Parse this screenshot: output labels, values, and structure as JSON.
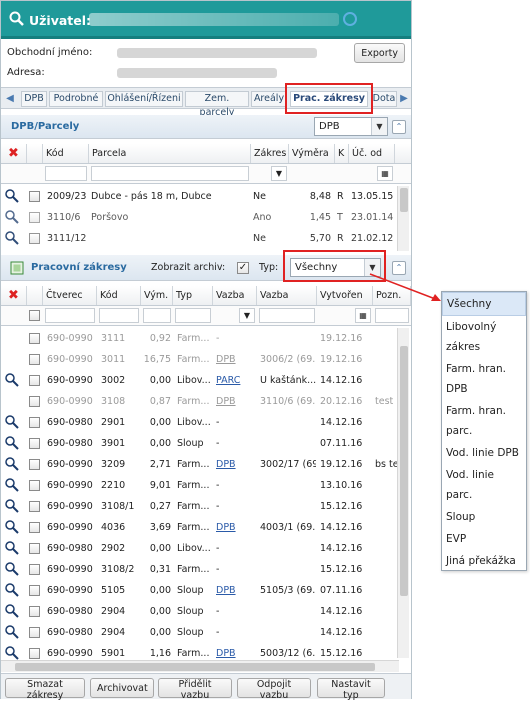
{
  "header": {
    "title": "Uživatel:"
  },
  "info": {
    "business_label": "Obchodní jméno:",
    "address_label": "Adresa:",
    "export_button": "Exporty"
  },
  "tabs": [
    "DPB",
    "Podrobné",
    "Ohlášení/Řízeni",
    "Zem. parcely",
    "Areály",
    "Prac. zákresy",
    "Dota"
  ],
  "dpb_section": {
    "title": "DPB/Parcely",
    "select_value": "DPB",
    "columns": [
      "Kód",
      "Parcela",
      "Zákres",
      "Výměra",
      "K",
      "Úč. od"
    ],
    "rows": [
      {
        "kod": "2009/23",
        "parcela": "Dubce - pás 18 m, Dubce",
        "zakres": "Ne",
        "vymera": "8,48",
        "k": "R",
        "uc": "13.05.15"
      },
      {
        "kod": "3110/6",
        "parcela": "Poršovo",
        "zakres": "Ano",
        "vymera": "1,45",
        "k": "T",
        "uc": "23.01.14"
      },
      {
        "kod": "3111/12",
        "parcela": "",
        "zakres": "Ne",
        "vymera": "5,70",
        "k": "R",
        "uc": "21.02.12"
      }
    ]
  },
  "work_section": {
    "title": "Pracovní zákresy",
    "archive_label": "Zobrazit archiv:",
    "type_label": "Typ:",
    "type_value": "Všechny",
    "columns": [
      "Čtverec",
      "Kód",
      "Vým.",
      "Typ",
      "Vazba",
      "Vazba popis",
      "Vytvořen",
      "Pozn."
    ],
    "rows": [
      {
        "grey": true,
        "mag": false,
        "ctverec": "690-0990",
        "kod": "3111",
        "vym": "0,92",
        "typ": "Farm...",
        "vazba": "-",
        "vlink": false,
        "popis": "",
        "vytvoren": "19.12.16",
        "pozn": ""
      },
      {
        "grey": true,
        "mag": false,
        "ctverec": "690-0990",
        "kod": "3011",
        "vym": "16,75",
        "typ": "Farm...",
        "vazba": "DPB",
        "vlink": true,
        "popis": "3006/2 (69...",
        "vytvoren": "19.12.16",
        "pozn": ""
      },
      {
        "grey": false,
        "mag": true,
        "ctverec": "690-0990",
        "kod": "3002",
        "vym": "0,00",
        "typ": "Libov...",
        "vazba": "PARC",
        "vlink": true,
        "popis": "U kaštánk...",
        "vytvoren": "14.12.16",
        "pozn": ""
      },
      {
        "grey": true,
        "mag": false,
        "ctverec": "690-0990",
        "kod": "3108",
        "vym": "0,87",
        "typ": "Farm...",
        "vazba": "DPB",
        "vlink": true,
        "popis": "3110/6 (69...",
        "vytvoren": "20.12.16",
        "pozn": "test"
      },
      {
        "grey": false,
        "mag": true,
        "ctverec": "690-0980",
        "kod": "2901",
        "vym": "0,00",
        "typ": "Libov...",
        "vazba": "-",
        "vlink": false,
        "popis": "",
        "vytvoren": "14.12.16",
        "pozn": ""
      },
      {
        "grey": false,
        "mag": true,
        "ctverec": "690-0980",
        "kod": "3901",
        "vym": "0,00",
        "typ": "Sloup",
        "vazba": "-",
        "vlink": false,
        "popis": "",
        "vytvoren": "07.11.16",
        "pozn": ""
      },
      {
        "grey": false,
        "mag": true,
        "ctverec": "690-0990",
        "kod": "3209",
        "vym": "2,71",
        "typ": "Farm...",
        "vazba": "DPB",
        "vlink": true,
        "popis": "3002/17 (69...",
        "vytvoren": "19.12.16",
        "pozn": "bs te"
      },
      {
        "grey": false,
        "mag": true,
        "ctverec": "690-0990",
        "kod": "2210",
        "vym": "9,01",
        "typ": "Farm...",
        "vazba": "-",
        "vlink": false,
        "popis": "",
        "vytvoren": "13.10.16",
        "pozn": ""
      },
      {
        "grey": false,
        "mag": true,
        "ctverec": "690-0990",
        "kod": "3108/1",
        "vym": "0,27",
        "typ": "Farm...",
        "vazba": "-",
        "vlink": false,
        "popis": "",
        "vytvoren": "15.12.16",
        "pozn": ""
      },
      {
        "grey": false,
        "mag": true,
        "ctverec": "690-0990",
        "kod": "4036",
        "vym": "3,69",
        "typ": "Farm...",
        "vazba": "DPB",
        "vlink": true,
        "popis": "4003/1 (69...",
        "vytvoren": "14.12.16",
        "pozn": ""
      },
      {
        "grey": false,
        "mag": true,
        "ctverec": "690-0980",
        "kod": "2902",
        "vym": "0,00",
        "typ": "Libov...",
        "vazba": "-",
        "vlink": false,
        "popis": "",
        "vytvoren": "14.12.16",
        "pozn": ""
      },
      {
        "grey": false,
        "mag": true,
        "ctverec": "690-0990",
        "kod": "3108/2",
        "vym": "0,31",
        "typ": "Farm...",
        "vazba": "-",
        "vlink": false,
        "popis": "",
        "vytvoren": "15.12.16",
        "pozn": ""
      },
      {
        "grey": false,
        "mag": true,
        "ctverec": "690-0990",
        "kod": "5105",
        "vym": "0,00",
        "typ": "Sloup",
        "vazba": "DPB",
        "vlink": true,
        "popis": "5105/3 (69...",
        "vytvoren": "07.11.16",
        "pozn": ""
      },
      {
        "grey": false,
        "mag": true,
        "ctverec": "690-0980",
        "kod": "2904",
        "vym": "0,00",
        "typ": "Sloup",
        "vazba": "-",
        "vlink": false,
        "popis": "",
        "vytvoren": "14.12.16",
        "pozn": ""
      },
      {
        "grey": false,
        "mag": true,
        "ctverec": "690-0980",
        "kod": "2904",
        "vym": "0,00",
        "typ": "Sloup",
        "vazba": "-",
        "vlink": false,
        "popis": "",
        "vytvoren": "14.12.16",
        "pozn": ""
      },
      {
        "grey": false,
        "mag": true,
        "ctverec": "690-0990",
        "kod": "5901",
        "vym": "1,16",
        "typ": "Farm...",
        "vazba": "DPB",
        "vlink": true,
        "popis": "5003/12 (6...",
        "vytvoren": "15.12.16",
        "pozn": ""
      }
    ]
  },
  "bottom_buttons": [
    "Smazat zákresy",
    "Archivovat",
    "Přidělit vazbu",
    "Odpojit vazbu",
    "Nastavit typ"
  ],
  "type_dropdown": {
    "options": [
      "Všechny",
      "Libovolný zákres",
      "Farm. hran. DPB",
      "Farm. hran. parc.",
      "Vod. linie DPB",
      "Vod. linie parc.",
      "Sloup",
      "EVP",
      "Jiná překážka"
    ]
  },
  "colors": {
    "header": "#1f9a9a",
    "highlight": "#e02222",
    "link": "#2a5aa8"
  }
}
